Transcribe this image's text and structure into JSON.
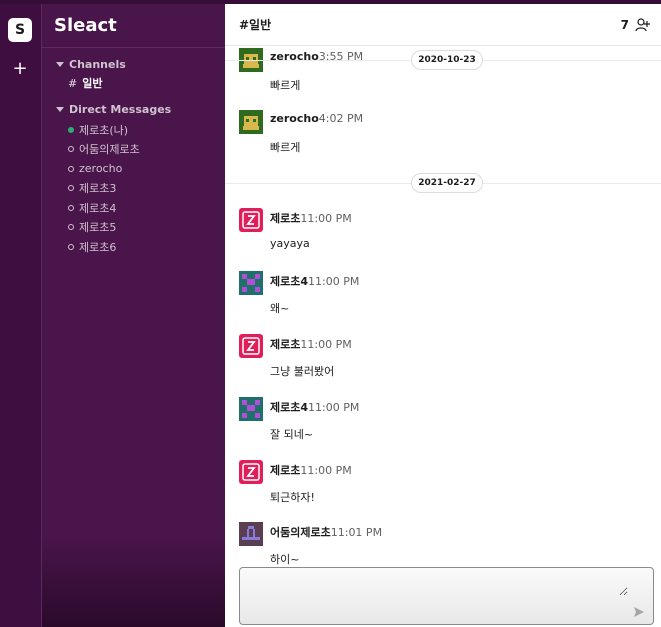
{
  "workspace": {
    "initial": "S",
    "name": "Sleact",
    "add_label": "+"
  },
  "sidebar": {
    "channels_title": "Channels",
    "channels": [
      {
        "hash": "#",
        "label": "일반"
      }
    ],
    "dm_title": "Direct Messages",
    "dms": [
      {
        "label": "제로초(나)",
        "online": true
      },
      {
        "label": "어둠의제로초",
        "online": false
      },
      {
        "label": "zerocho",
        "online": false
      },
      {
        "label": "제로초3",
        "online": false
      },
      {
        "label": "제로초4",
        "online": false
      },
      {
        "label": "제로초5",
        "online": false
      },
      {
        "label": "제로초6",
        "online": false
      }
    ]
  },
  "chat": {
    "title": "#일반",
    "member_count": "7",
    "dividers": [
      "2020-10-23",
      "2021-02-27"
    ],
    "messages": [
      {
        "sender": "zerocho",
        "time": "3:55 PM",
        "text": "빠르게"
      },
      {
        "sender": "zerocho",
        "time": "4:02 PM",
        "text": "빠르게"
      },
      {
        "sender": "제로초",
        "time": "11:00 PM",
        "text": "yayaya"
      },
      {
        "sender": "제로초4",
        "time": "11:00 PM",
        "text": "왜~"
      },
      {
        "sender": "제로초",
        "time": "11:00 PM",
        "text": "그냥 불러봤어"
      },
      {
        "sender": "제로초4",
        "time": "11:00 PM",
        "text": "잘 되네~"
      },
      {
        "sender": "제로초",
        "time": "11:00 PM",
        "text": "퇴근하자!"
      },
      {
        "sender": "어둠의제로초",
        "time": "11:01 PM",
        "text": "하이~"
      }
    ],
    "composer_placeholder": ""
  },
  "colors": {
    "sidebar": "#4a154b",
    "rail": "#3f0e40",
    "online": "#2bac76",
    "accent_red": "#e01e5a"
  },
  "icons": {
    "add_member": "add-user-icon",
    "send": "send-icon",
    "caret": "caret-down-icon"
  }
}
